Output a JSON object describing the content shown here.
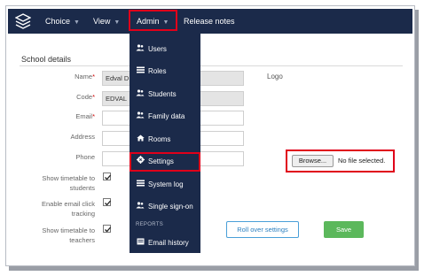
{
  "nav": {
    "items": [
      {
        "label": "Choice"
      },
      {
        "label": "View"
      },
      {
        "label": "Admin"
      },
      {
        "label": "Release notes"
      }
    ]
  },
  "section": {
    "title": "School details"
  },
  "form": {
    "name_label": "Name",
    "name_value": "Edval D",
    "code_label": "Code",
    "code_value": "EDVAL",
    "email_label": "Email",
    "address_label": "Address",
    "phone_label": "Phone",
    "required_marker": "*",
    "show_timetable_students": "Show timetable to students",
    "enable_email_click": "Enable email click tracking",
    "show_timetable_teachers": "Show timetable to teachers",
    "logo_label": "Logo",
    "browse_label": "Browse...",
    "no_file_text": "No file selected."
  },
  "buttons": {
    "rollover": "Roll over settings",
    "save": "Save"
  },
  "admin_menu": {
    "items": [
      {
        "label": "Users",
        "icon": "users-icon"
      },
      {
        "label": "Roles",
        "icon": "list-icon"
      },
      {
        "label": "Students",
        "icon": "users-icon"
      },
      {
        "label": "Family data",
        "icon": "users-icon"
      },
      {
        "label": "Rooms",
        "icon": "home-icon"
      },
      {
        "label": "Settings",
        "icon": "gear-icon"
      },
      {
        "label": "System log",
        "icon": "list-icon"
      },
      {
        "label": "Single sign-on",
        "icon": "users-icon"
      }
    ],
    "reports_header": "REPORTS",
    "report_items": [
      {
        "label": "Email history",
        "icon": "card-icon"
      }
    ]
  },
  "colors": {
    "navbar": "#1b2a4a",
    "highlight": "#e0001a",
    "save": "#5cb85c",
    "link": "#2a7fc0"
  }
}
